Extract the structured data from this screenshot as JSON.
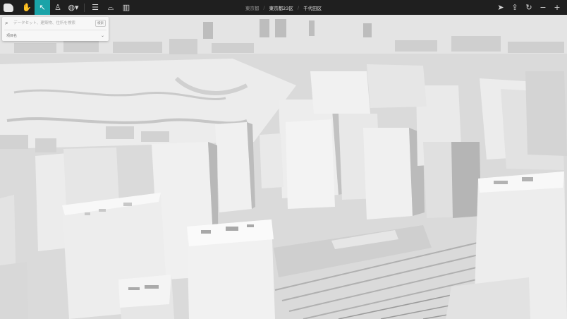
{
  "toolbar": {
    "tools": [
      {
        "name": "hand-tool-icon",
        "glyph": "✋",
        "active": false
      },
      {
        "name": "cursor-tool-icon",
        "glyph": "↖",
        "active": true
      },
      {
        "name": "pin-tool-icon",
        "glyph": "♙",
        "active": false
      },
      {
        "name": "globe-tool-icon",
        "glyph": "◍",
        "active": false
      }
    ],
    "breadcrumb": [
      "東京都",
      "東京都23区",
      "千代田区"
    ],
    "right_icons": [
      {
        "name": "locate-icon",
        "glyph": "➤"
      },
      {
        "name": "share-icon",
        "glyph": "⇪"
      },
      {
        "name": "rotate-icon",
        "glyph": "↻"
      },
      {
        "name": "zoom-out-icon",
        "glyph": "−"
      },
      {
        "name": "zoom-in-icon",
        "glyph": "+"
      }
    ]
  },
  "search": {
    "placeholder": "データセット、建築物、住所を検索",
    "chip": "検索",
    "filter_label": "項目名"
  },
  "colors": {
    "toolbar": "#1f1f1f",
    "accent": "#1aa3a8",
    "building_light": "#f2f2f2",
    "building_mid": "#cfcfcf",
    "building_dark": "#a9a9a9",
    "ground": "#d6d6d6"
  }
}
